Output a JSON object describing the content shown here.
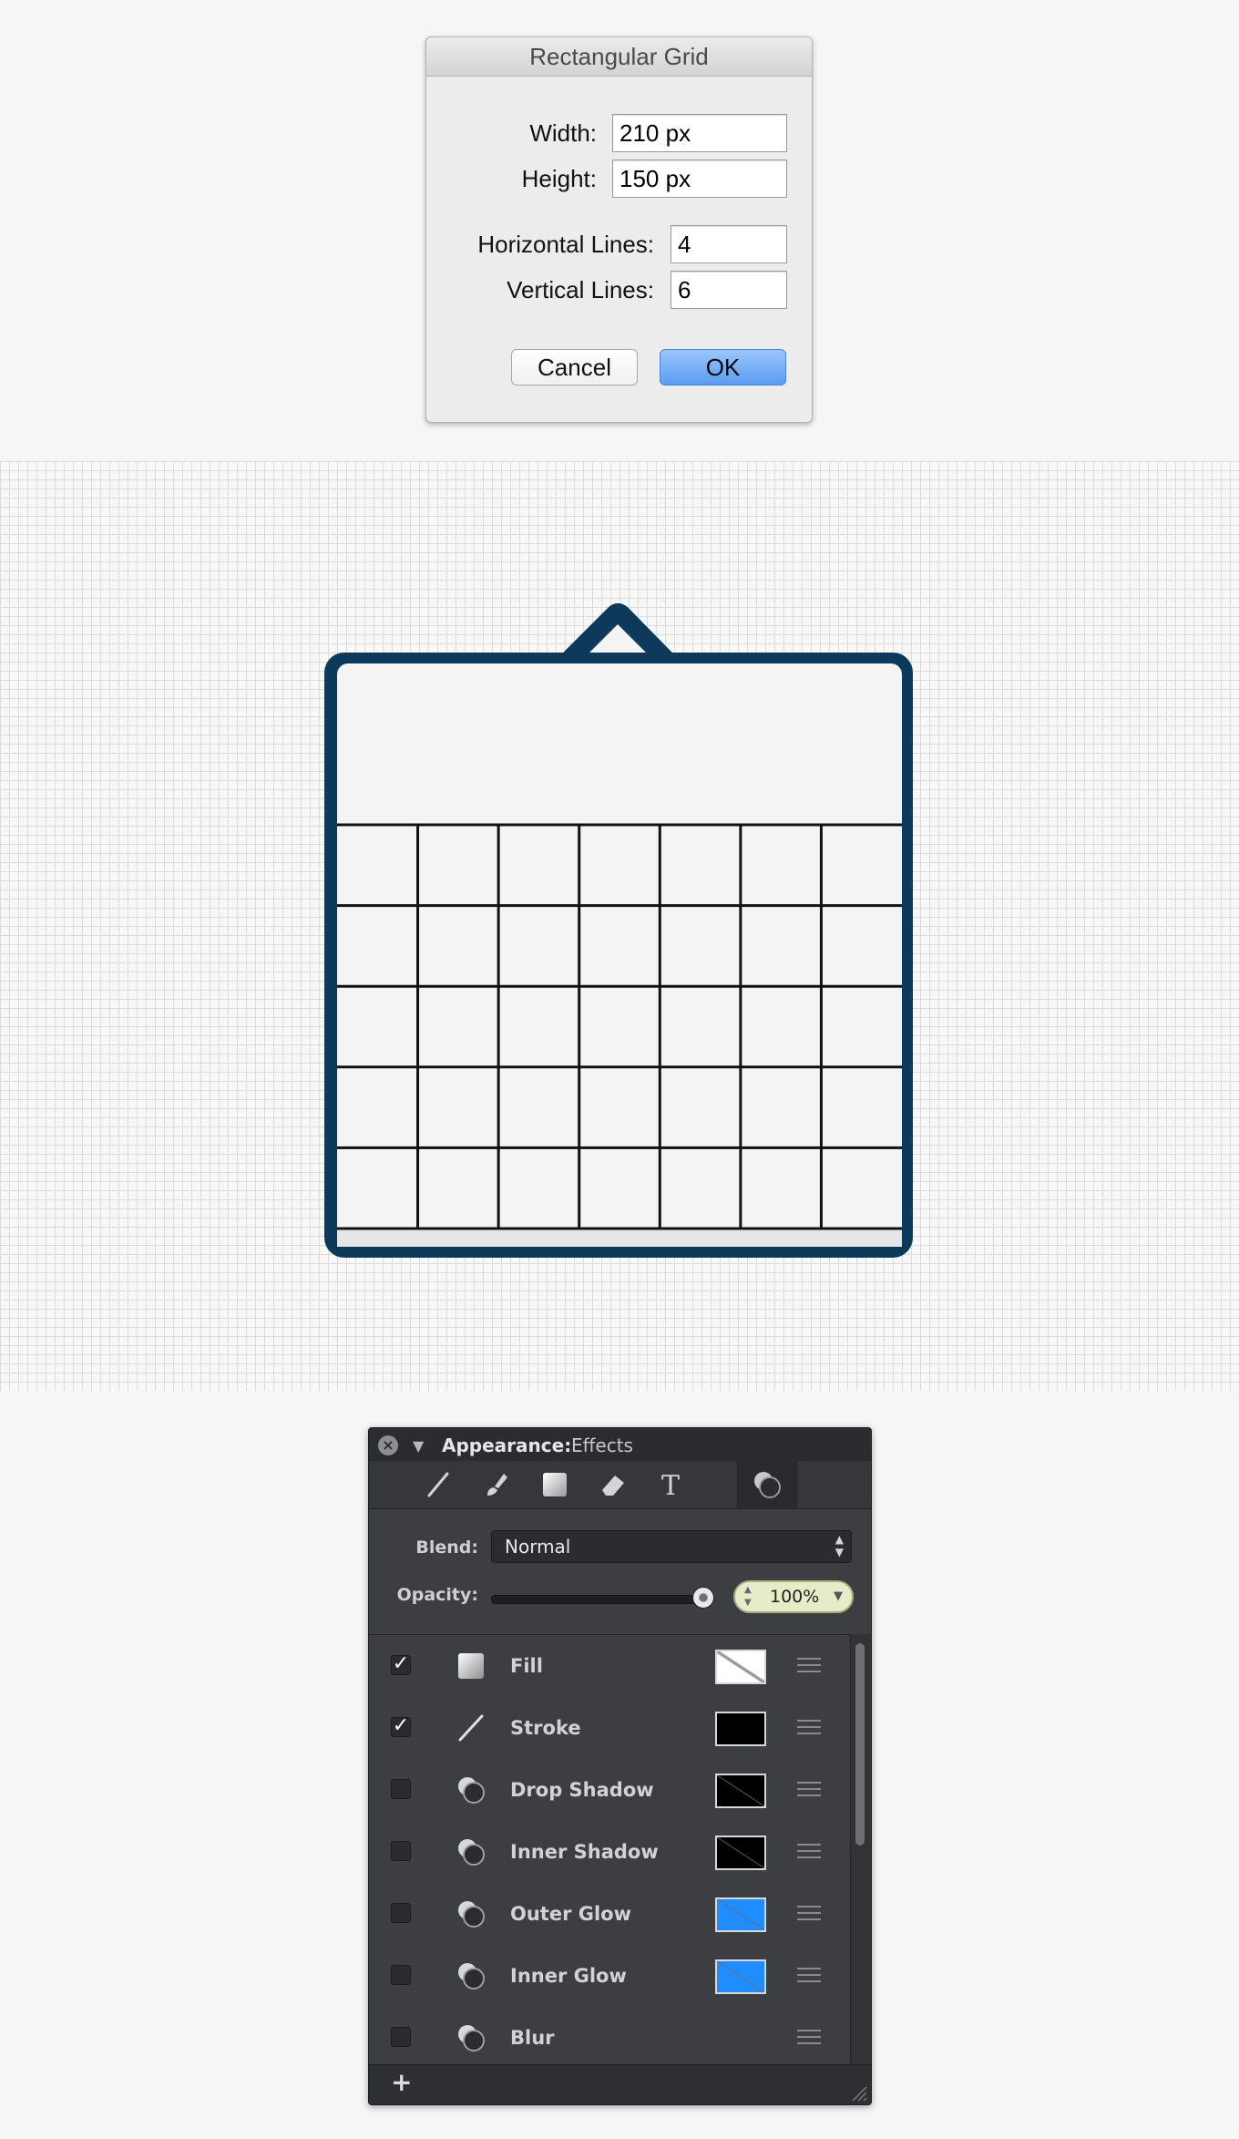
{
  "dialog": {
    "title": "Rectangular Grid",
    "width_label": "Width:",
    "width_value": "210 px",
    "height_label": "Height:",
    "height_value": "150 px",
    "hlines_label": "Horizontal Lines:",
    "hlines_value": "4",
    "vlines_label": "Vertical Lines:",
    "vlines_value": "6",
    "cancel_label": "Cancel",
    "ok_label": "OK"
  },
  "canvas": {
    "frame_color": "#0d3a5a",
    "fill_color": "#f4f4f4",
    "grid_line_color": "#111111",
    "grid_rows": 5,
    "grid_columns": 7
  },
  "panel": {
    "title": "Appearance:",
    "subtitle": "Effects",
    "close_icon": "close-icon",
    "tools": [
      "line-tool-icon",
      "brush-tool-icon",
      "shape-tool-icon",
      "eraser-tool-icon",
      "text-tool-icon",
      "effects-tool-icon"
    ],
    "blend_label": "Blend:",
    "blend_value": "Normal",
    "opacity_label": "Opacity:",
    "opacity_value": "100%",
    "opacity_fraction": 1.0,
    "add_label": "+",
    "effects": [
      {
        "label": "Fill",
        "checked": true,
        "icon": "fill-icon",
        "swatch": "none"
      },
      {
        "label": "Stroke",
        "checked": true,
        "icon": "stroke-icon",
        "swatch": "#000000"
      },
      {
        "label": "Drop Shadow",
        "checked": false,
        "icon": "shadow-icon",
        "swatch": "#000000"
      },
      {
        "label": "Inner Shadow",
        "checked": false,
        "icon": "shadow-icon",
        "swatch": "#000000"
      },
      {
        "label": "Outer Glow",
        "checked": false,
        "icon": "glow-icon",
        "swatch": "#1f8cff"
      },
      {
        "label": "Inner Glow",
        "checked": false,
        "icon": "glow-icon",
        "swatch": "#1f8cff"
      },
      {
        "label": "Blur",
        "checked": false,
        "icon": "blur-icon",
        "swatch": ""
      }
    ]
  }
}
